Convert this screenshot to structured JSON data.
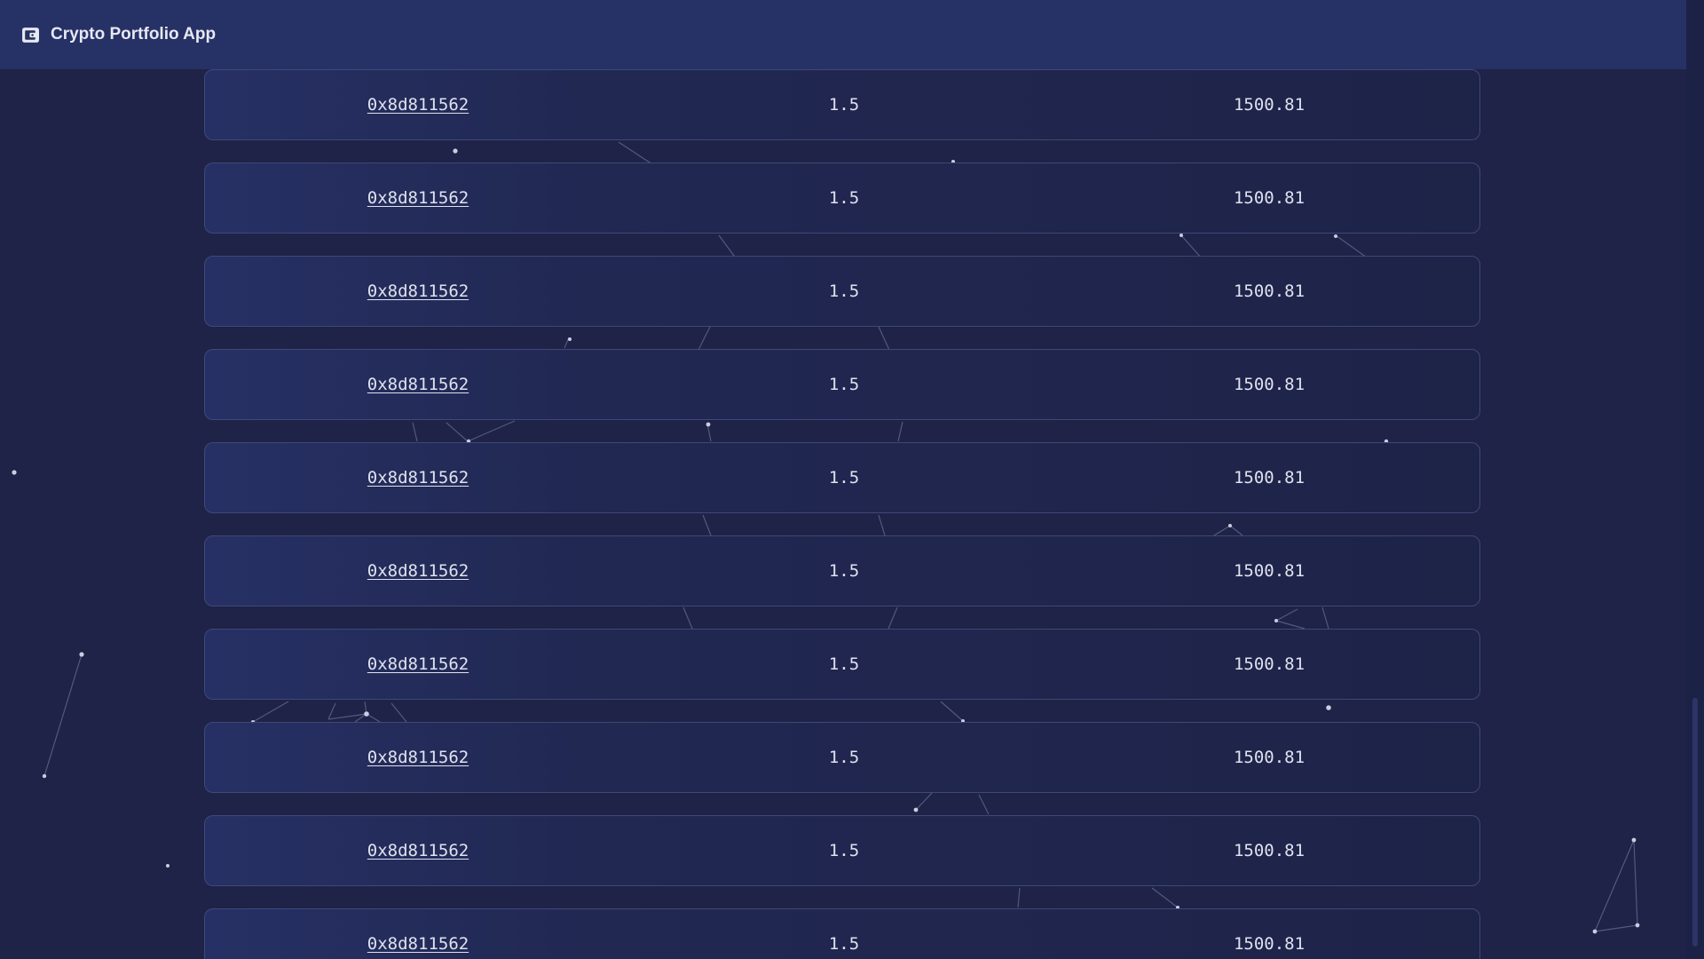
{
  "app": {
    "title": "Crypto Portfolio App",
    "icon": "wallet-icon"
  },
  "colors": {
    "background": "#1e2347",
    "header": "#263165",
    "row_border": "#3f4878",
    "text": "#dfe2ee"
  },
  "transactions": [
    {
      "hash": "0x8d811562",
      "amount": "1.5",
      "value": "1500.81"
    },
    {
      "hash": "0x8d811562",
      "amount": "1.5",
      "value": "1500.81"
    },
    {
      "hash": "0x8d811562",
      "amount": "1.5",
      "value": "1500.81"
    },
    {
      "hash": "0x8d811562",
      "amount": "1.5",
      "value": "1500.81"
    },
    {
      "hash": "0x8d811562",
      "amount": "1.5",
      "value": "1500.81"
    },
    {
      "hash": "0x8d811562",
      "amount": "1.5",
      "value": "1500.81"
    },
    {
      "hash": "0x8d811562",
      "amount": "1.5",
      "value": "1500.81"
    },
    {
      "hash": "0x8d811562",
      "amount": "1.5",
      "value": "1500.81"
    },
    {
      "hash": "0x8d811562",
      "amount": "1.5",
      "value": "1500.81"
    },
    {
      "hash": "0x8d811562",
      "amount": "1.5",
      "value": "1500.81"
    }
  ]
}
